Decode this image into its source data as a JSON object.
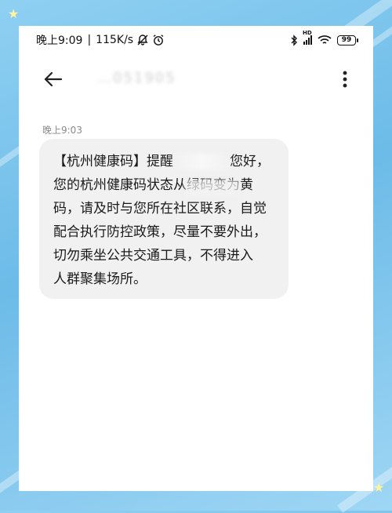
{
  "status_bar": {
    "time": "晚上9:09",
    "network_speed": "115K/s",
    "separator": "|",
    "mute_icon": "bell-off-icon",
    "alarm_icon": "alarm-icon",
    "bluetooth_icon": "bluetooth-icon",
    "signal_label": "HD",
    "wifi_icon": "wifi-icon",
    "battery": "99"
  },
  "app_bar": {
    "back_icon": "back-arrow-icon",
    "contact": "…051905",
    "more_icon": "more-vertical-icon"
  },
  "message": {
    "timestamp": "晚上9:03",
    "lines": [
      "【杭州健康码】提醒",
      "您好，",
      "您的杭州健康码状态从绿码变为黄",
      "码，请及时与您所在社区联系，自觉",
      "配合执行防控政策，尽量不要外出，",
      "切勿乘坐公共交通工具，不得进入",
      "人群聚集场所。"
    ]
  },
  "colors": {
    "background": "#7cc4ec",
    "bubble": "#f1f1f1",
    "text": "#1a1a1a"
  }
}
